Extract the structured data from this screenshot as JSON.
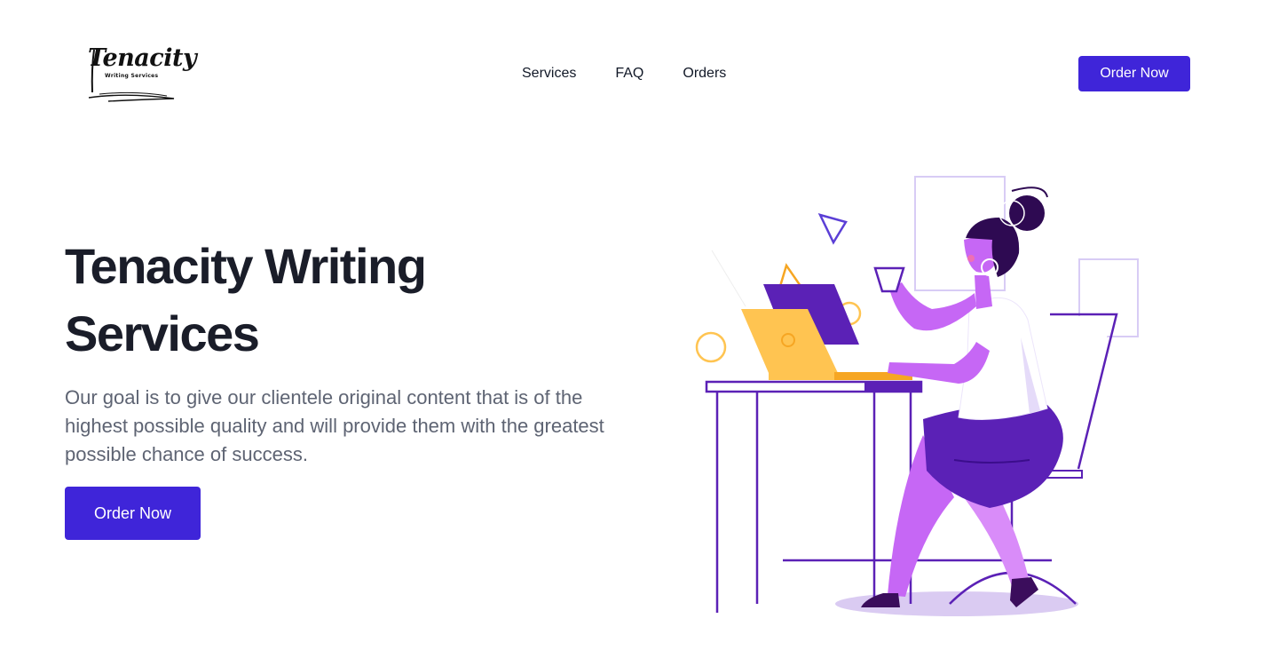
{
  "header": {
    "logo": {
      "title": "Tenacity",
      "subtitle": "Writing  Services"
    },
    "nav": [
      {
        "label": "Services"
      },
      {
        "label": "FAQ"
      },
      {
        "label": "Orders"
      }
    ],
    "cta_label": "Order Now"
  },
  "hero": {
    "title": "Tenacity Writing Services",
    "description": "Our goal is to give our clientele original content that is of the highest possible quality and will provide them with the greatest possible chance of success.",
    "cta_label": "Order Now"
  },
  "colors": {
    "accent": "#3f25d9",
    "heading": "#1a1d29",
    "body_text": "#5e6473",
    "purple": "#5b21b6",
    "light_purple": "#c667f5",
    "yellow": "#ffc451"
  }
}
